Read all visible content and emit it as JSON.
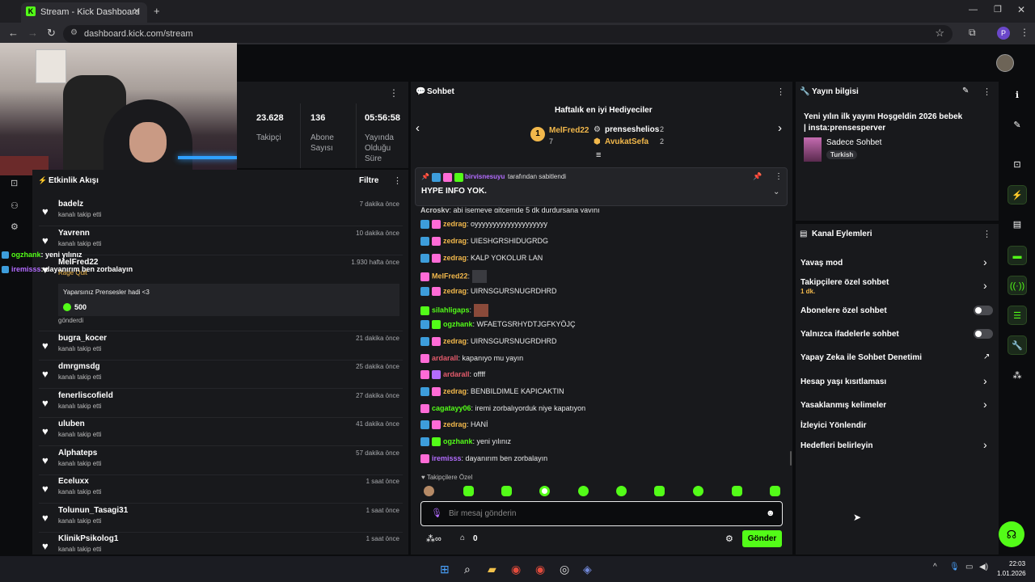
{
  "browser": {
    "tab_title": "Stream - Kick Dashboard",
    "url": "dashboard.kick.com/stream",
    "profile_initial": "P"
  },
  "stats": [
    {
      "value": "23.628",
      "label": "Takipçi"
    },
    {
      "value": "136",
      "label": "Abone Sayısı"
    },
    {
      "value": "05:56:58",
      "label": "Yayında Olduğu Süre"
    }
  ],
  "activity": {
    "title": "Etkinlik Akışı",
    "filter_label": "Filtre",
    "items": [
      {
        "name": "badelz",
        "sub": "kanalı takip etti",
        "time": "7 dakika önce"
      },
      {
        "name": "Yavrenn",
        "sub": "kanalı takip etti",
        "time": "10 dakika önce"
      },
      {
        "name": "MelFred22",
        "sub": "Rage Quit",
        "time": "1.930 hafta önce"
      },
      {
        "name": "bugra_kocer",
        "sub": "kanalı takip etti",
        "time": "21 dakika önce"
      },
      {
        "name": "dmrgmsdg",
        "sub": "kanalı takip etti",
        "time": "25 dakika önce"
      },
      {
        "name": "fenerliscofield",
        "sub": "kanalı takip etti",
        "time": "27 dakika önce"
      },
      {
        "name": "uluben",
        "sub": "kanalı takip etti",
        "time": "41 dakika önce"
      },
      {
        "name": "Alphateps",
        "sub": "kanalı takip etti",
        "time": "57 dakika önce"
      },
      {
        "name": "Eceluxx",
        "sub": "kanalı takip etti",
        "time": "1 saat önce"
      },
      {
        "name": "Tolunun_Tasagi31",
        "sub": "kanalı takip etti",
        "time": "1 saat önce"
      },
      {
        "name": "KlinikPsikolog1",
        "sub": "kanalı takip etti",
        "time": "1 saat önce"
      }
    ],
    "gift_message": "Yaparsınız Prensesler hadi <3",
    "gift_amount": "500",
    "gift_sent": "gönderdi"
  },
  "overlay_chat": [
    {
      "user": "ogzhank",
      "text": "yeni yılınız"
    },
    {
      "user": "iremisss",
      "text": "dayanırım ben zorbalayın"
    }
  ],
  "chat": {
    "title": "Sohbet",
    "gifters_title": "Haftalık en iyi Hediyeciler",
    "top_gifter": {
      "rank": "1",
      "name": "MelFred22",
      "count": "7"
    },
    "gifters": [
      {
        "name": "prenseshelios",
        "count": "2"
      },
      {
        "name": "AvukatSefa",
        "count": "2"
      }
    ],
    "pinned_by": "birvisnesuyu",
    "pinned_suffix": "tarafından sabitlendi",
    "pinned_message": "HYPE INFO YOK.",
    "partial_line": {
      "user": "Acrosky",
      "text": "abi işemeye gitcemde 5 dk durdursana yayını"
    },
    "messages": [
      {
        "user": "zedrag",
        "text": "oyyyyyyyyyyyyyyyyyyyy",
        "color": "#f2b84b"
      },
      {
        "user": "zedrag",
        "text": "UIESHGRSHIDUGRDG",
        "color": "#f2b84b"
      },
      {
        "user": "zedrag",
        "text": "KALP YOKOLUR LAN",
        "color": "#f2b84b"
      },
      {
        "user": "MelFred22",
        "text": "",
        "color": "#f2b84b"
      },
      {
        "user": "zedrag",
        "text": "UIRNSGURSNUGRDHRD",
        "color": "#f2b84b"
      },
      {
        "user": "silahligaps",
        "text": "",
        "color": "#53fc18"
      },
      {
        "user": "ogzhank",
        "text": "WFAETGSRHYDTJGFKYÖJÇ",
        "color": "#53fc18"
      },
      {
        "user": "zedrag",
        "text": "UIRNSGURSNUGRDHRD",
        "color": "#f2b84b"
      },
      {
        "user": "ardarall",
        "text": "kapanıyo mu yayın",
        "color": "#e45b6b"
      },
      {
        "user": "ardarall",
        "text": "offff",
        "color": "#e45b6b"
      },
      {
        "user": "zedrag",
        "text": "BENBILDIMLE KAPICAKTIN",
        "color": "#f2b84b"
      },
      {
        "user": "cagatayy06",
        "text": "iremi zorbalıyorduk niye kapatıyon",
        "color": "#53fc18"
      },
      {
        "user": "zedrag",
        "text": "HANİ",
        "color": "#f2b84b"
      },
      {
        "user": "ogzhank",
        "text": "yeni yılınız",
        "color": "#53fc18"
      },
      {
        "user": "iremisss",
        "text": "dayanırım ben zorbalayın",
        "color": "#b36cff"
      }
    ],
    "followers_only": "Takipçilere Özel",
    "input_placeholder": "Bir mesaj gönderin",
    "points": "0",
    "send_label": "Gönder"
  },
  "stream_info": {
    "title": "Yayın bilgisi",
    "stream_title": "Yeni yılın ilk yayını Hoşgeldin 2026 bebek | insta:prensesperver",
    "category": "Sadece Sohbet",
    "tag": "Turkish"
  },
  "channel_actions": {
    "title": "Kanal Eylemleri",
    "items": [
      {
        "label": "Yavaş mod",
        "control": "chevron"
      },
      {
        "label": "Takipçilere özel sohbet",
        "sub": "1 dk.",
        "control": "chevron"
      },
      {
        "label": "Abonelere özel sohbet",
        "control": "toggle"
      },
      {
        "label": "Yalnızca ifadelerle sohbet",
        "control": "toggle"
      },
      {
        "label": "Yapay Zeka ile Sohbet Denetimi",
        "control": "external"
      },
      {
        "label": "Hesap yaşı kısıtlaması",
        "control": "chevron"
      },
      {
        "label": "Yasaklanmış kelimeler",
        "control": "chevron"
      },
      {
        "label": "İzleyici Yönlendir",
        "control": "none"
      },
      {
        "label": "Hedefleri belirleyin",
        "control": "chevron"
      }
    ]
  },
  "taskbar": {
    "time": "22:03",
    "date": "1.01.2026"
  },
  "colors": {
    "accent": "#53fc18",
    "panel": "#18191c",
    "background": "#0b0c0e"
  }
}
